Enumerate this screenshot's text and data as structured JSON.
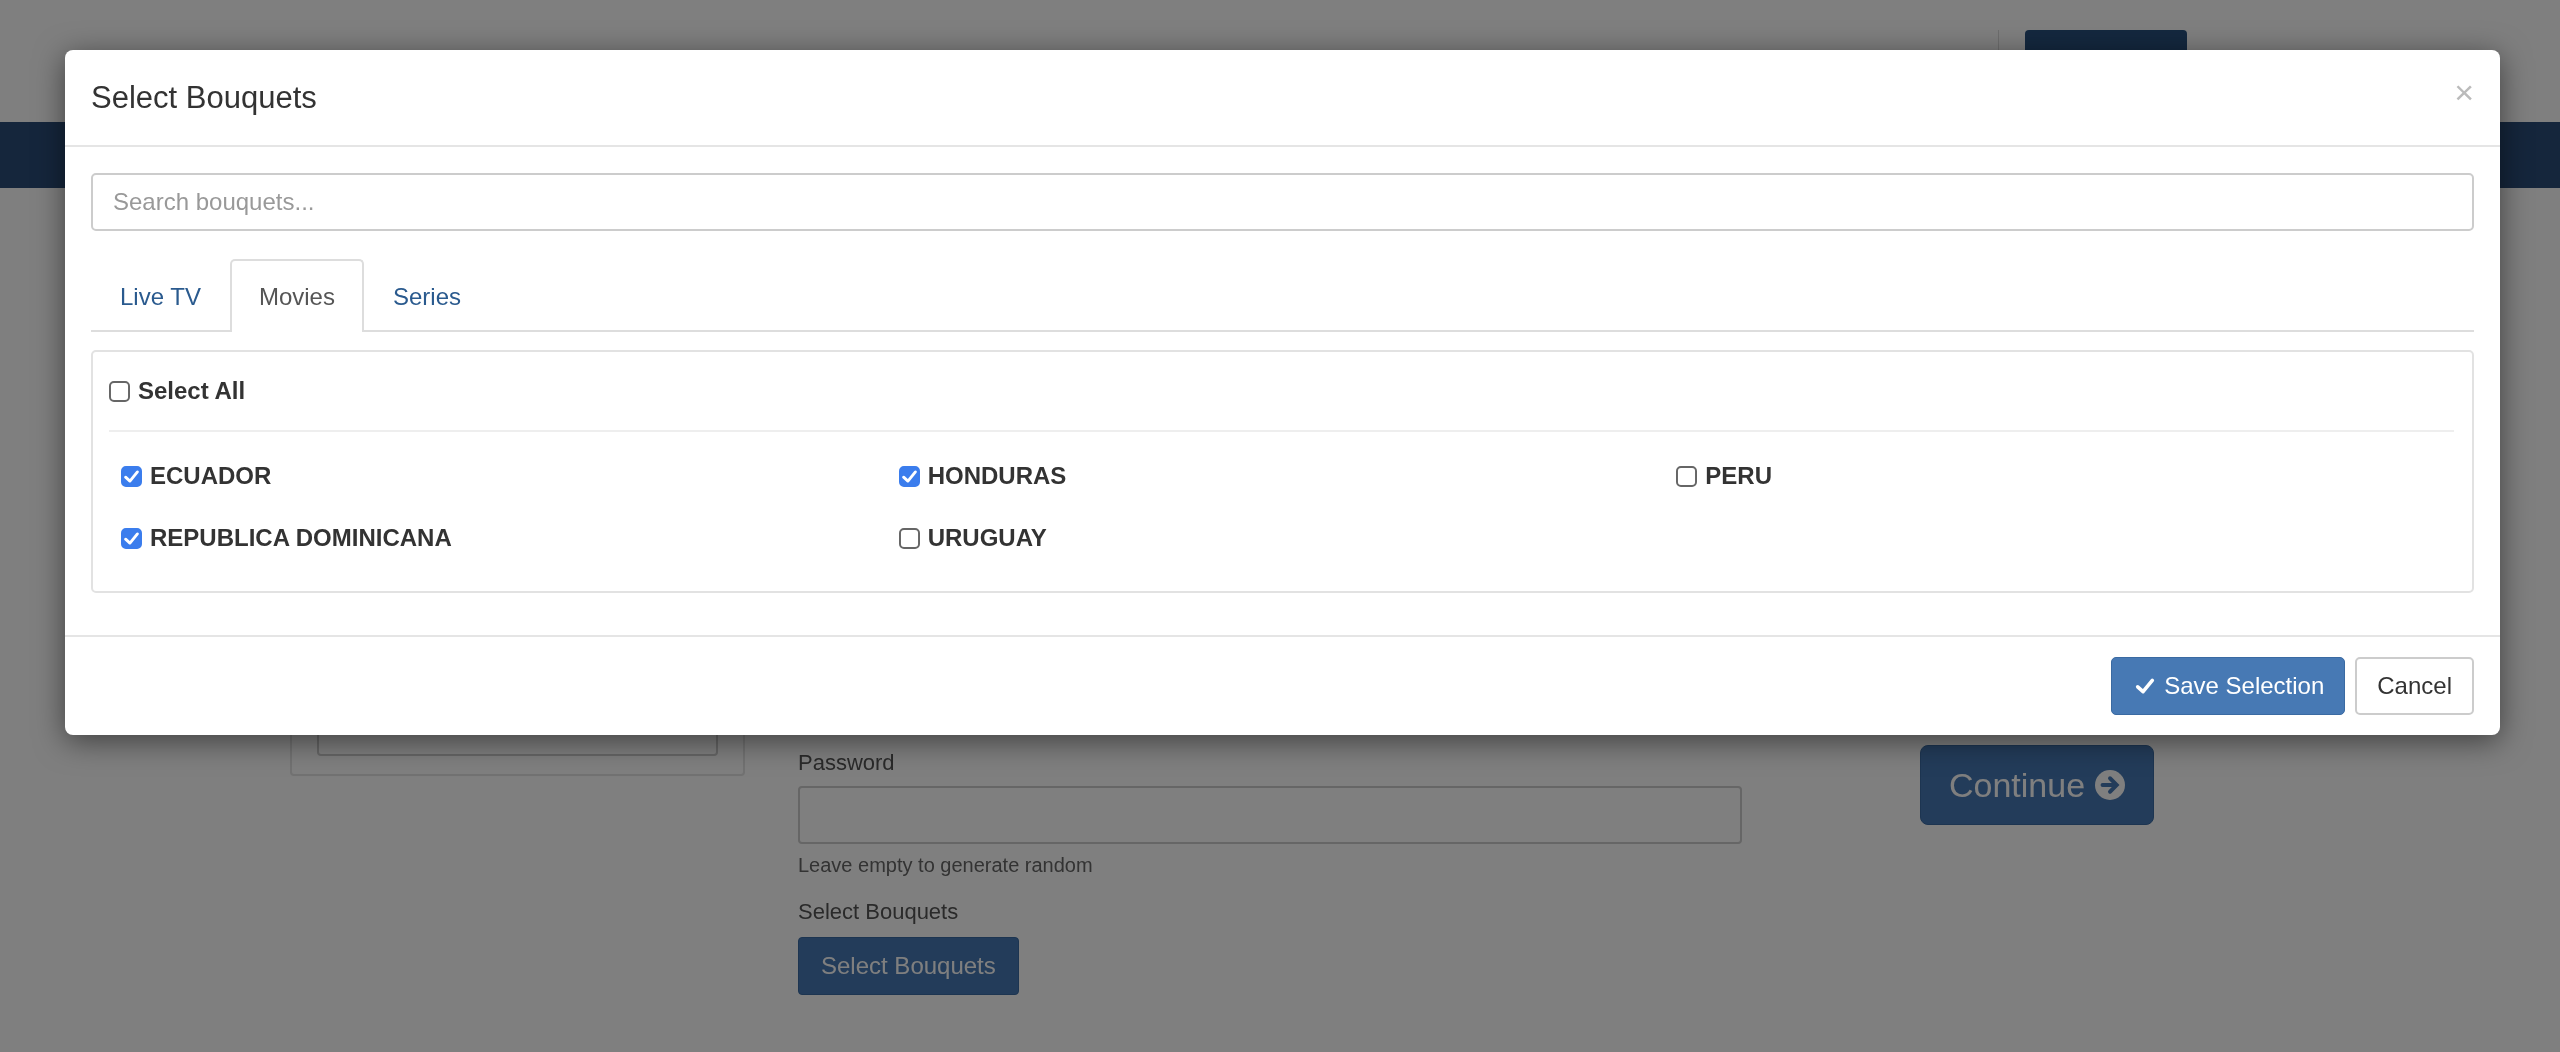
{
  "page": {
    "password_label": "Password",
    "password_hint": "Leave empty to generate random",
    "bouquets_label": "Select Bouquets",
    "bouquets_button": "Select Bouquets",
    "continue_button": "Continue"
  },
  "modal": {
    "title": "Select Bouquets",
    "close": "×",
    "search": {
      "placeholder": "Search bouquets..."
    },
    "tabs": [
      {
        "label": "Live TV",
        "selected": false
      },
      {
        "label": "Movies",
        "selected": true
      },
      {
        "label": "Series",
        "selected": false
      }
    ],
    "select_all": {
      "label": "Select All",
      "checked": false
    },
    "bouquets": [
      {
        "label": "ECUADOR",
        "checked": true
      },
      {
        "label": "HONDURAS",
        "checked": true
      },
      {
        "label": "PERU",
        "checked": false
      },
      {
        "label": "REPUBLICA DOMINICANA",
        "checked": true
      },
      {
        "label": "URUGUAY",
        "checked": false
      }
    ],
    "buttons": [
      {
        "label": "Save Selection",
        "kind": "primary"
      },
      {
        "label": "Cancel",
        "kind": "default"
      }
    ]
  }
}
